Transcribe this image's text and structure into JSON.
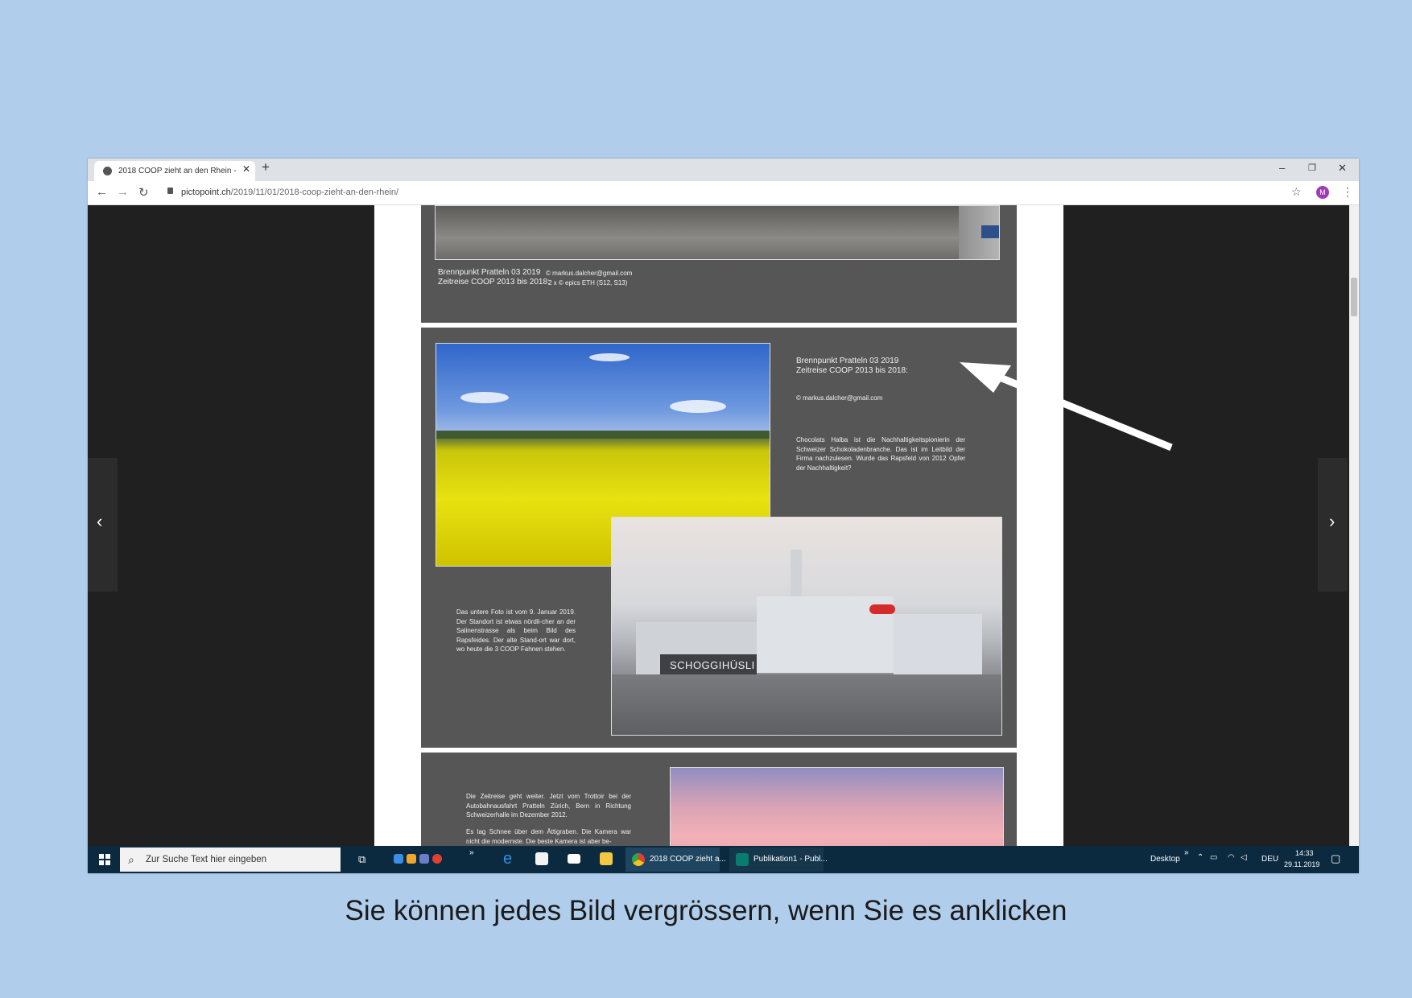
{
  "browser": {
    "tab_title": "2018 COOP zieht an den Rhein -",
    "url_host": "pictopoint.ch",
    "url_path": "/2019/11/01/2018-coop-zieht-an-den-rhein/",
    "avatar_letter": "M"
  },
  "panel1": {
    "line1": "Brennpunkt Pratteln 03 2019",
    "line2": "Zeitreise  COOP 2013 bis 2018:",
    "credit1": "© markus.dalcher@gmail.com",
    "credit2": "2 x © epics ETH  (S12, S13)"
  },
  "panel2": {
    "title1": "Brennpunkt Pratteln 03 2019",
    "title2": "Zeitreise  COOP 2013 bis 2018:",
    "email": "© markus.dalcher@gmail.com",
    "paragraph": "Chocolats Halba ist die Nachhaltigkeitspionierin der Schweizer Schokoladenbranche. Das ist im Leitbild der Firma nachzulesen.  Wurde das Rapsfeld von 2012 Opfer der Nachhaltigkeit?",
    "lower_text": "Das untere Foto ist vom 9. Januar 2019. Der Standort ist etwas nördli-cher an der Salinenstrasse als beim Bild des Rapsfeides. Der alte Stand-ort war dort, wo heute die 3 COOP Fahnen stehen.",
    "photo_sign": "SCHOGGIHÜSLI"
  },
  "panel3": {
    "text1": "Die Zeitreise geht weiter. Jetzt vom Trottoir bei der Autobahnausfahrt Pratteln  Zürich, Bern in Richtung Schweizerhalle im Dezember 2012.",
    "text2": "Es lag Schnee über dem Ättigraben. Die Kamera war nicht die modernste. Die beste Kamera ist  aber be-"
  },
  "taskbar": {
    "search_placeholder": "Zur Suche Text hier eingeben",
    "app_chrome": "2018 COOP zieht a...",
    "app_publisher": "Publikation1 - Publ...",
    "desktop_label": "Desktop",
    "language": "DEU",
    "time": "14:33",
    "date": "29.11.2019"
  },
  "caption": "Sie können jedes Bild vergrössern, wenn Sie es anklicken",
  "colors": {
    "background": "#b0cdeb",
    "panel": "#565656",
    "taskbar": "#0b2a3f"
  }
}
